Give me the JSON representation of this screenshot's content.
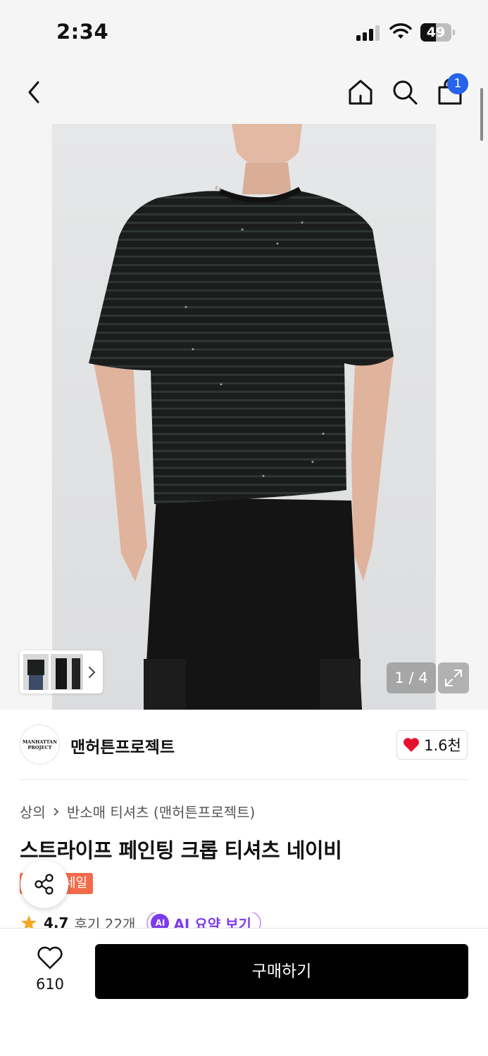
{
  "status_bar": {
    "time": "2:34",
    "battery": "49",
    "battery_level": 0.49
  },
  "nav": {
    "cart_count": "1"
  },
  "gallery": {
    "counter": "1 / 4"
  },
  "brand": {
    "logo_text": "MANHATTAN PROJECT",
    "name": "맨허튼프로젝트",
    "like_count": "1.6천"
  },
  "product": {
    "breadcrumb": [
      "상의",
      "반소매 티셔츠 (맨허튼프로젝트)"
    ],
    "title": "스트라이프 페인팅 크롭 티셔츠 네이비",
    "sale_badge": "세일",
    "rating": "4.7",
    "reviews": "후기 22개",
    "ai_label": "AI",
    "ai_summary": "AI 요약 보기"
  },
  "bottom_bar": {
    "wish_count": "610",
    "buy_label": "구매하기"
  },
  "colors": {
    "badge_blue": "#2563eb",
    "sale_orange": "#f26b4b",
    "heart_red": "#e8112d",
    "ai_purple": "#7c3aed"
  }
}
